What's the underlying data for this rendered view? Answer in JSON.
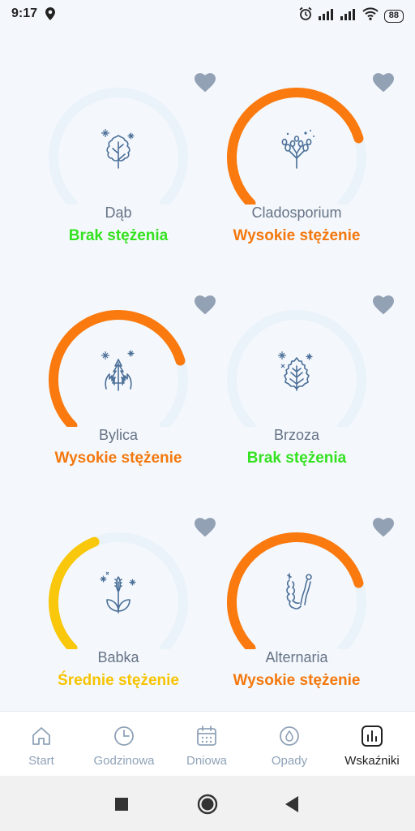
{
  "status_bar": {
    "time": "9:17",
    "battery": "88"
  },
  "colors": {
    "high": "#fa7a0f",
    "medium": "#f7c300",
    "none": "#33e21f",
    "track": "#eaf2fa",
    "heart": "#93a1b5",
    "icon_stroke": "#4b6f98"
  },
  "allergens": [
    {
      "name": "Dąb",
      "level": "Brak stężenia",
      "level_color": "#33e21f",
      "gauge_fraction": 0.0,
      "gauge_color": "#fa7a0f",
      "icon": "oak-leaf-icon"
    },
    {
      "name": "Cladosporium",
      "level": "Wysokie stężenie",
      "level_color": "#f4780d",
      "gauge_fraction": 0.77,
      "gauge_color": "#fa7a0f",
      "icon": "cladosporium-spores-icon"
    },
    {
      "name": "Bylica",
      "level": "Wysokie stężenie",
      "level_color": "#f4780d",
      "gauge_fraction": 0.77,
      "gauge_color": "#fa7a0f",
      "icon": "mugwort-leaf-icon"
    },
    {
      "name": "Brzoza",
      "level": "Brak stężenia",
      "level_color": "#33e21f",
      "gauge_fraction": 0.0,
      "gauge_color": "#fa7a0f",
      "icon": "birch-leaf-icon"
    },
    {
      "name": "Babka",
      "level": "Średnie stężenie",
      "level_color": "#f7c300",
      "gauge_fraction": 0.42,
      "gauge_color": "#f9c70b",
      "icon": "plantain-plant-icon"
    },
    {
      "name": "Alternaria",
      "level": "Wysokie stężenie",
      "level_color": "#f4780d",
      "gauge_fraction": 0.77,
      "gauge_color": "#fa7a0f",
      "icon": "alternaria-spores-icon"
    }
  ],
  "bottom_nav": [
    {
      "label": "Start",
      "icon": "home-icon",
      "active": false
    },
    {
      "label": "Godzinowa",
      "icon": "clock-icon",
      "active": false
    },
    {
      "label": "Dniowa",
      "icon": "calendar-icon",
      "active": false
    },
    {
      "label": "Opady",
      "icon": "drop-icon",
      "active": false
    },
    {
      "label": "Wskaźniki",
      "icon": "bar-chart-icon",
      "active": true
    }
  ]
}
